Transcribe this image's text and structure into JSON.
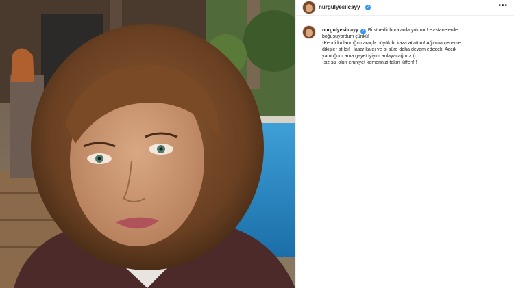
{
  "post": {
    "username": "nurgulyesilcayy",
    "more_icon": "more-horizontal-icon",
    "verified_icon": "verified-badge-icon",
    "caption_lines": [
      "Bi süredir buralarda yoktum! Hastanelerde",
      "boğuşuyordum çünkü!",
      "-Kendi kullandığım araçla büyük bi kaza atlattım! Ağzıma,çeneme",
      "dikişler atıldı! Hasar kaldı ve bi süre daha devam edecek! Accık",
      "yamuğum ama gayet iyiyim anlayacağınız:))",
      "-siz siz olun emniyet kemerinizi takın lütfen!!!"
    ],
    "accent_color": "#3897f0"
  }
}
